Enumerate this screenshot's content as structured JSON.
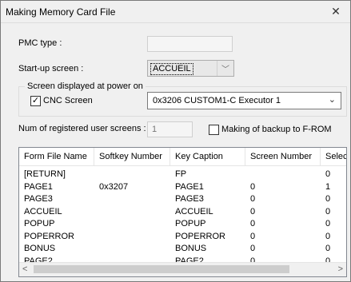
{
  "window": {
    "title": "Making Memory Card File"
  },
  "icons": {
    "close": "close-icon",
    "dropdown": "chevron-down-icon",
    "check": "checkmark-icon",
    "scroll_left": "arrow-left-icon",
    "scroll_right": "arrow-right-icon"
  },
  "pmc_type": {
    "label": "PMC type :",
    "value": ""
  },
  "startup": {
    "label": "Start-up screen :",
    "value": "ACCUEIL"
  },
  "power_on_group": {
    "title": "Screen displayed at power on",
    "cnc_checkbox_label": "CNC Screen",
    "cnc_checked": true,
    "screen_value": "0x3206  CUSTOM1-C Executor 1"
  },
  "num_screens": {
    "label": "Num of registered user screens :",
    "value": "1"
  },
  "backup": {
    "label": "Making of backup to F-ROM",
    "checked": false
  },
  "table": {
    "columns": [
      "Form File Name",
      "Softkey Number",
      "Key Caption",
      "Screen Number",
      "Selec"
    ],
    "rows": [
      [
        "[RETURN]",
        "",
        "FP",
        "",
        "0"
      ],
      [
        "PAGE1",
        "0x3207",
        "PAGE1",
        "0",
        "1"
      ],
      [
        "PAGE3",
        "",
        "PAGE3",
        "0",
        "0"
      ],
      [
        "ACCUEIL",
        "",
        "ACCUEIL",
        "0",
        "0"
      ],
      [
        "POPUP",
        "",
        "POPUP",
        "0",
        "0"
      ],
      [
        "POPERROR",
        "",
        "POPERROR",
        "0",
        "0"
      ],
      [
        "BONUS",
        "",
        "BONUS",
        "0",
        "0"
      ],
      [
        "PAGE2",
        "",
        "PAGE2",
        "0",
        "0"
      ]
    ]
  }
}
